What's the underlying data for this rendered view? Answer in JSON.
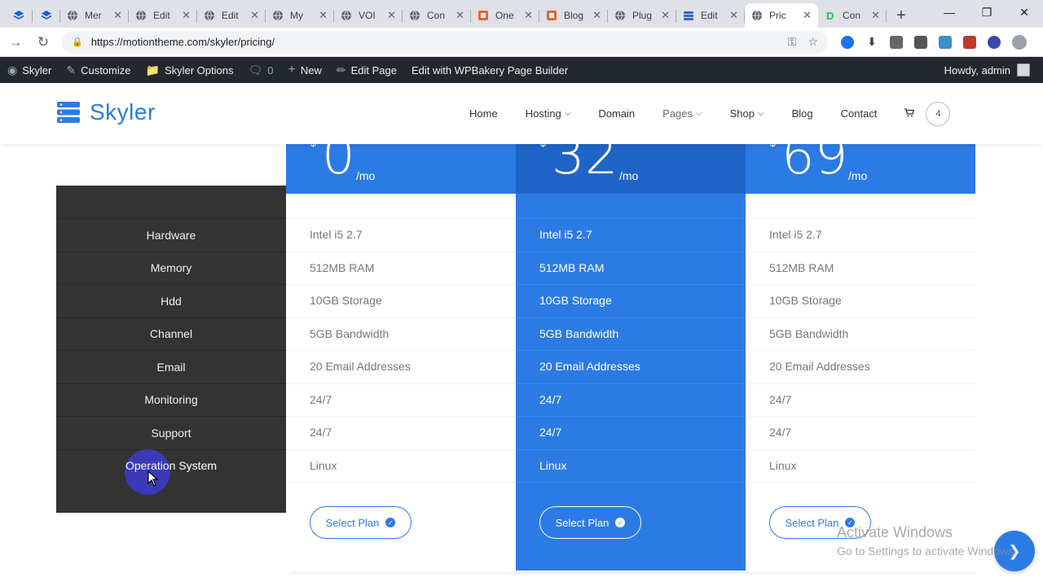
{
  "browser": {
    "tabs": [
      {
        "title": "",
        "icon": "layers-icon",
        "pinned": true
      },
      {
        "title": "",
        "icon": "layers-icon",
        "pinned": true
      },
      {
        "title": "Mer",
        "icon": "globe-icon"
      },
      {
        "title": "Edit",
        "icon": "globe-icon"
      },
      {
        "title": "Edit",
        "icon": "globe-icon"
      },
      {
        "title": "My",
        "icon": "globe-icon"
      },
      {
        "title": "VOI",
        "icon": "globe-icon"
      },
      {
        "title": "Con",
        "icon": "globe-icon"
      },
      {
        "title": "One",
        "icon": "orange-square-icon"
      },
      {
        "title": "Blog",
        "icon": "orange-square-icon"
      },
      {
        "title": "Plug",
        "icon": "globe-icon"
      },
      {
        "title": "Edit",
        "icon": "blue-stack-icon"
      },
      {
        "title": "Pric",
        "icon": "globe-icon",
        "active": true
      },
      {
        "title": "Con",
        "icon": "green-d-icon"
      }
    ],
    "new_tab": "+",
    "url": "https://motiontheme.com/skyler/pricing/"
  },
  "adminbar": {
    "site": "Skyler",
    "customize": "Customize",
    "options": "Skyler Options",
    "comments": "0",
    "new": "New",
    "edit_page": "Edit Page",
    "wpbakery": "Edit with WPBakery Page Builder",
    "howdy": "Howdy, admin"
  },
  "site": {
    "logo": "Skyler",
    "nav": [
      {
        "label": "Home",
        "dropdown": false
      },
      {
        "label": "Hosting",
        "dropdown": true
      },
      {
        "label": "Domain",
        "dropdown": false
      },
      {
        "label": "Pages",
        "dropdown": true
      },
      {
        "label": "Shop",
        "dropdown": true
      },
      {
        "label": "Blog",
        "dropdown": false
      },
      {
        "label": "Contact",
        "dropdown": false
      }
    ],
    "cart_count": "4"
  },
  "pricing": {
    "features": [
      "Hardware",
      "Memory",
      "Hdd",
      "Channel",
      "Email",
      "Monitoring",
      "Support",
      "Operation System"
    ],
    "plans": [
      {
        "currency": "$",
        "price": "0",
        "period": "/mo",
        "featured": false,
        "values": [
          "Intel i5 2.7",
          "512MB RAM",
          "10GB Storage",
          "5GB Bandwidth",
          "20 Email Addresses",
          "24/7",
          "24/7",
          "Linux"
        ],
        "button": "Select Plan"
      },
      {
        "currency": "$",
        "price": "32",
        "period": "/mo",
        "featured": true,
        "values": [
          "Intel i5 2.7",
          "512MB RAM",
          "10GB Storage",
          "5GB Bandwidth",
          "20 Email Addresses",
          "24/7",
          "24/7",
          "Linux"
        ],
        "button": "Select Plan"
      },
      {
        "currency": "$",
        "price": "69",
        "period": "/mo",
        "featured": false,
        "values": [
          "Intel i5 2.7",
          "512MB RAM",
          "10GB Storage",
          "5GB Bandwidth",
          "20 Email Addresses",
          "24/7",
          "24/7",
          "Linux"
        ],
        "button": "Select Plan"
      }
    ]
  },
  "watermark": {
    "line1": "Activate Windows",
    "line2": "Go to Settings to activate Windows."
  },
  "colors": {
    "brand_blue": "#2c7be5",
    "featured_header": "#1f65c7",
    "feature_column": "#333333",
    "admin_bar": "#23282d"
  }
}
